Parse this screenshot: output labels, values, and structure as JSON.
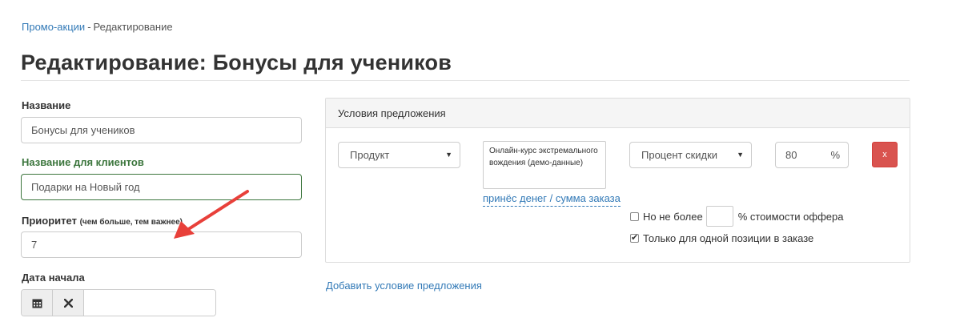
{
  "breadcrumb": {
    "parent": "Промо-акции",
    "separator": "-",
    "current": "Редактирование"
  },
  "page_title": "Редактирование: Бонусы для учеников",
  "form": {
    "name_label": "Название",
    "name_value": "Бонусы для учеников",
    "client_name_label": "Название для клиентов",
    "client_name_value": "Подарки на Новый год",
    "priority_label": "Приоритет",
    "priority_hint": "(чем больше, тем важнее)",
    "priority_value": "7",
    "start_date_label": "Дата начала",
    "start_date_value": "",
    "calendar_icon": "calendar-icon",
    "clear_icon": "clear-icon"
  },
  "conditions": {
    "heading": "Условия предложения",
    "type_select": "Продукт",
    "product": "Онлайн-курс экстремального вождения (демо-данные)",
    "money_link": "принёс денег / сумма заказа",
    "discount_select": "Процент скидки",
    "discount_value": "80",
    "discount_unit": "%",
    "delete_label": "x",
    "max_label": "Но не более",
    "max_value": "",
    "max_suffix": "% стоимости оффера",
    "max_checked": false,
    "single_label": "Только для одной позиции в заказе",
    "single_checked": true,
    "add_condition": "Добавить условие предложения"
  },
  "colors": {
    "link": "#337ab7",
    "success": "#3c763d",
    "danger": "#d9534f",
    "annotation_arrow": "#e8403a"
  }
}
